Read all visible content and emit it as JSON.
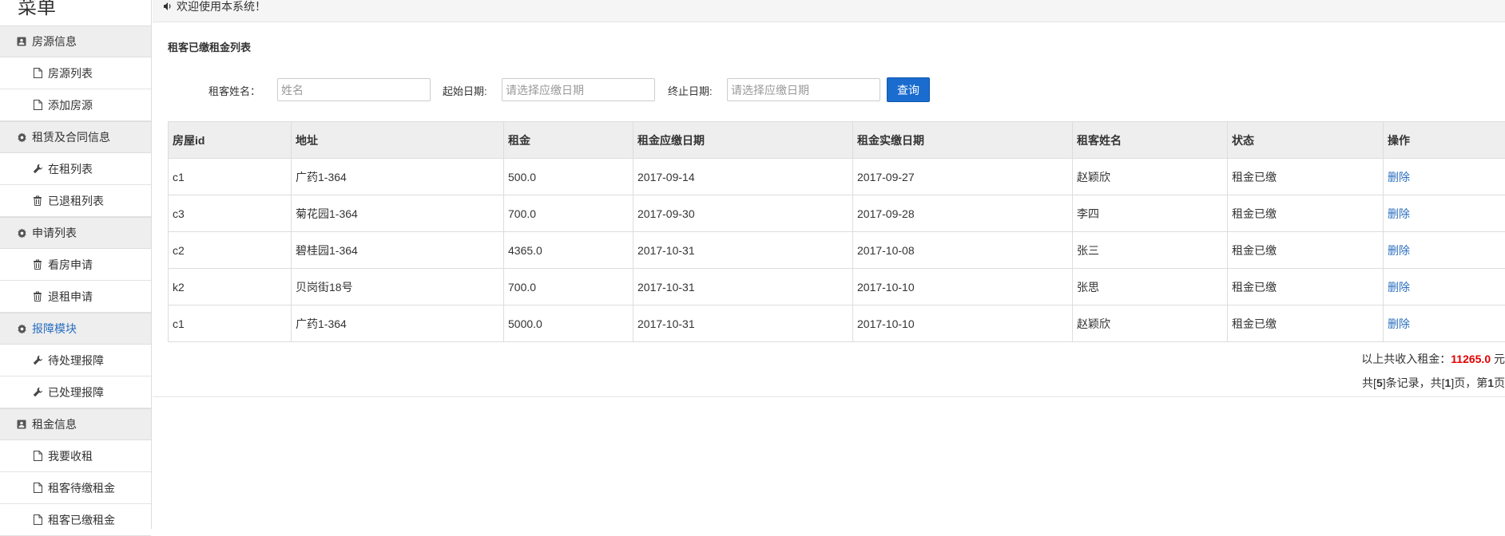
{
  "sidebar": {
    "title": "菜单",
    "groups": [
      {
        "label": "房源信息",
        "icon": "user-card-icon",
        "items": [
          {
            "label": "房源列表",
            "icon": "file-icon"
          },
          {
            "label": "添加房源",
            "icon": "file-icon"
          }
        ]
      },
      {
        "label": "租赁及合同信息",
        "icon": "gear-icon",
        "items": [
          {
            "label": "在租列表",
            "icon": "wrench-icon"
          },
          {
            "label": "已退租列表",
            "icon": "trash-icon"
          }
        ]
      },
      {
        "label": "申请列表",
        "icon": "gear-icon",
        "items": [
          {
            "label": "看房申请",
            "icon": "trash-icon"
          },
          {
            "label": "退租申请",
            "icon": "trash-icon"
          }
        ]
      },
      {
        "label": "报障模块",
        "icon": "gear-icon",
        "active": true,
        "items": [
          {
            "label": "待处理报障",
            "icon": "wrench-icon"
          },
          {
            "label": "已处理报障",
            "icon": "wrench-icon"
          }
        ]
      },
      {
        "label": "租金信息",
        "icon": "user-card-icon",
        "items": [
          {
            "label": "我要收租",
            "icon": "file-icon"
          },
          {
            "label": "租客待缴租金",
            "icon": "file-icon"
          },
          {
            "label": "租客已缴租金",
            "icon": "file-icon"
          }
        ]
      }
    ]
  },
  "topbar": {
    "welcome": "欢迎使用本系统！",
    "icon": "speaker-icon"
  },
  "page": {
    "title": "租客已缴租金列表"
  },
  "filters": {
    "name_label": "租客姓名：",
    "name_placeholder": "姓名",
    "start_label": "起始日期:",
    "start_placeholder": "请选择应缴日期",
    "end_label": "终止日期:",
    "end_placeholder": "请选择应缴日期",
    "query_label": "查询"
  },
  "table": {
    "headers": [
      "房屋id",
      "地址",
      "租金",
      "租金应缴日期",
      "租金实缴日期",
      "租客姓名",
      "状态",
      "操作"
    ],
    "rows": [
      [
        "c1",
        "广药1-364",
        "500.0",
        "2017-09-14",
        "2017-09-27",
        "赵颖欣",
        "租金已缴",
        "删除"
      ],
      [
        "c3",
        "菊花园1-364",
        "700.0",
        "2017-09-30",
        "2017-09-28",
        "李四",
        "租金已缴",
        "删除"
      ],
      [
        "c2",
        "碧桂园1-364",
        "4365.0",
        "2017-10-31",
        "2017-10-08",
        "张三",
        "租金已缴",
        "删除"
      ],
      [
        "k2",
        "贝岗街18号",
        "700.0",
        "2017-10-31",
        "2017-10-10",
        "张思",
        "租金已缴",
        "删除"
      ],
      [
        "c1",
        "广药1-364",
        "5000.0",
        "2017-10-31",
        "2017-10-10",
        "赵颖欣",
        "租金已缴",
        "删除"
      ]
    ]
  },
  "summary": {
    "total_prefix": "以上共收入租金：",
    "total_value": "11265.0",
    "total_suffix": " 元",
    "pager_a": "共[",
    "record_count": "5",
    "pager_b": "]条记录，共[",
    "page_count": "1",
    "pager_c": "]页，第",
    "current_page": "1",
    "pager_d": "页"
  },
  "colors": {
    "accent": "#1a6ccf",
    "link": "#2a6ebf",
    "total": "#e30000"
  }
}
